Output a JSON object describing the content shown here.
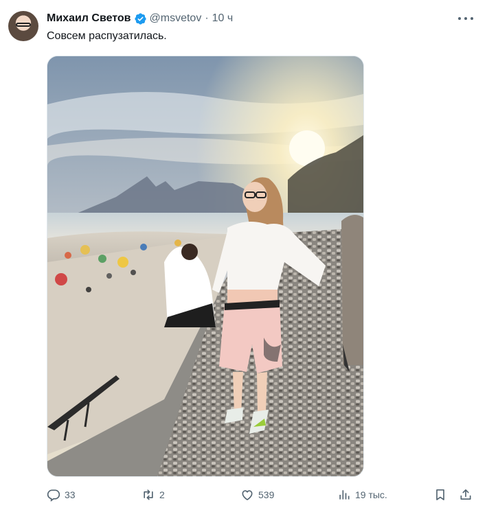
{
  "author": {
    "name": "Михаил Светов",
    "handle": "@msvetov",
    "separator": "·",
    "time": "10 ч",
    "verified": true
  },
  "tweet": {
    "text": "Совсем распузатилась."
  },
  "media": {
    "type": "photo"
  },
  "actions": {
    "replies": "33",
    "retweets": "2",
    "likes": "539",
    "views": "19 тыс."
  },
  "icons": {
    "verified": "verified-badge-icon",
    "more": "more-dots-icon",
    "reply": "reply-icon",
    "retweet": "retweet-icon",
    "like": "heart-icon",
    "views": "views-chart-icon",
    "bookmark": "bookmark-icon",
    "share": "share-icon"
  },
  "colors": {
    "text": "#0f1419",
    "secondary": "#536471",
    "verified": "#1d9bf0"
  }
}
